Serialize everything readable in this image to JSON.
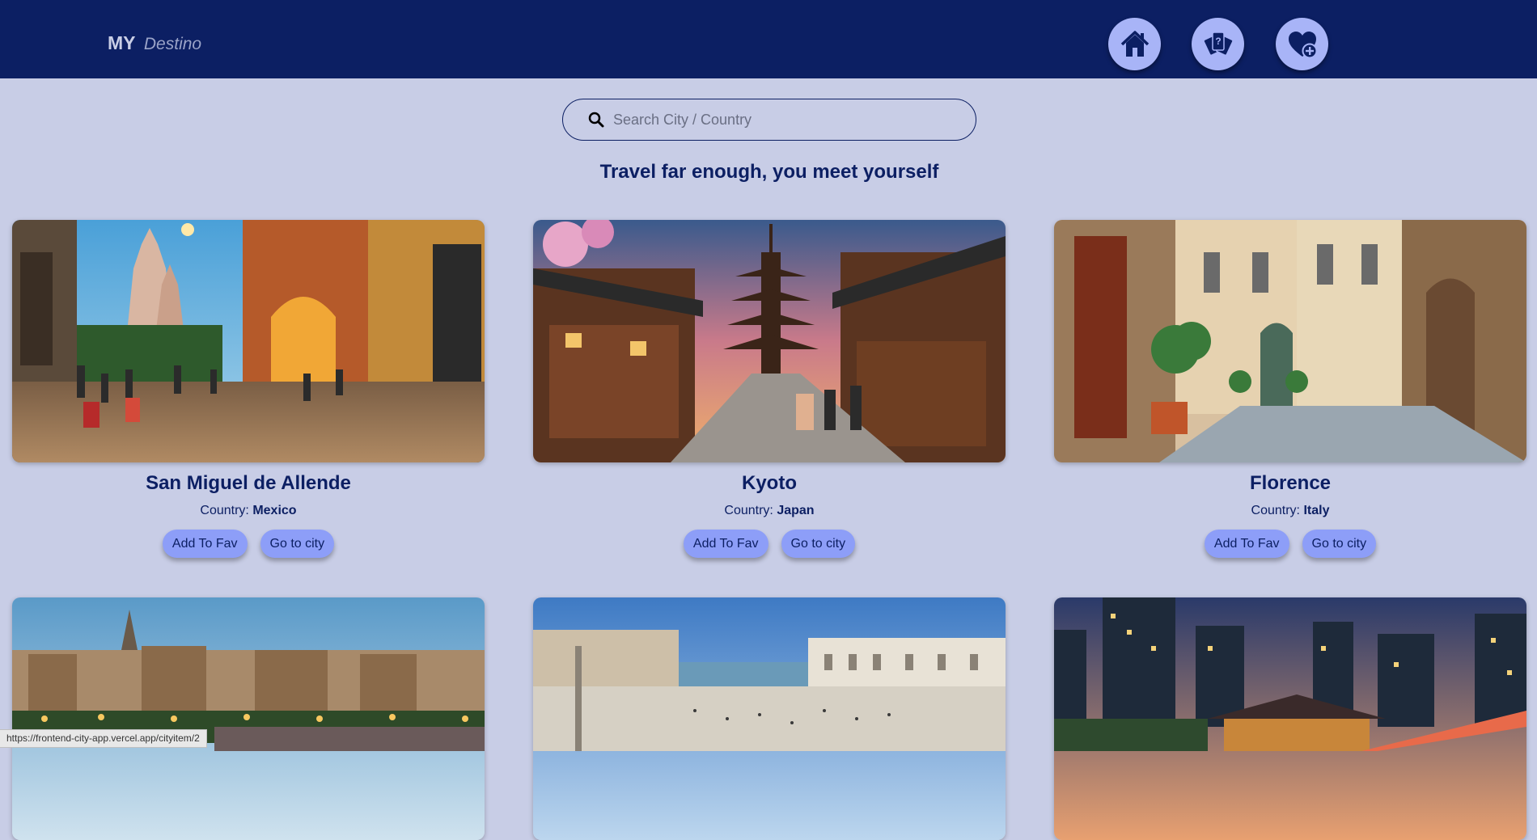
{
  "brand": {
    "my": "MY",
    "destino": "Destino"
  },
  "nav": {
    "buttons": [
      {
        "name": "home",
        "icon": "home-icon"
      },
      {
        "name": "quiz",
        "icon": "cards-icon"
      },
      {
        "name": "favorites",
        "icon": "heart-plus-icon"
      }
    ]
  },
  "search": {
    "placeholder": "Search City / Country",
    "icon": "search-icon"
  },
  "tagline": "Travel far enough, you meet yourself",
  "cards": [
    {
      "city": "San Miguel de Allende",
      "country_label": "Country:",
      "country": "Mexico",
      "fav_label": "Add To Fav",
      "go_label": "Go to city"
    },
    {
      "city": "Kyoto",
      "country_label": "Country:",
      "country": "Japan",
      "fav_label": "Add To Fav",
      "go_label": "Go to city"
    },
    {
      "city": "Florence",
      "country_label": "Country:",
      "country": "Italy",
      "fav_label": "Add To Fav",
      "go_label": "Go to city"
    }
  ],
  "status_url": "https://frontend-city-app.vercel.app/cityitem/2",
  "colors": {
    "navbar": "#0c1f63",
    "background": "#c8cde6",
    "button": "#8d9ef8",
    "nav_button": "#a8b4f7"
  }
}
